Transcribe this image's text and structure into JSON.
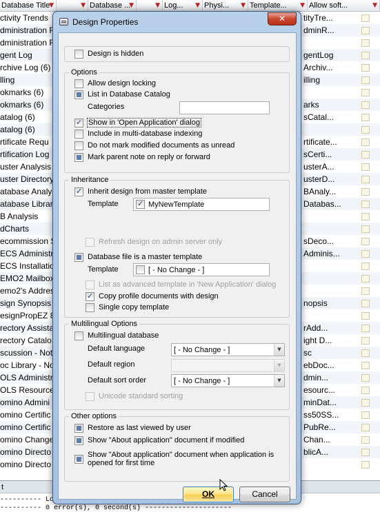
{
  "background": {
    "columns": [
      {
        "label": "Database Title",
        "width": 82
      },
      {
        "label": "",
        "width": 46
      },
      {
        "label": "Database ...",
        "width": 70
      },
      {
        "label": "",
        "width": 38
      },
      {
        "label": "Log...",
        "width": 58
      },
      {
        "label": "Physi...",
        "width": 66
      },
      {
        "label": "Template...",
        "width": 86
      },
      {
        "label": "Allow soft...",
        "width": 105
      }
    ],
    "rows": [
      {
        "title": "ctivity Trends",
        "template": "tityTre..."
      },
      {
        "title": "dministration R",
        "template": "dminR..."
      },
      {
        "title": "dministration R",
        "template": ""
      },
      {
        "title": "gent Log",
        "template": "gentLog"
      },
      {
        "title": "rchive Log (6)",
        "template": "Archiv..."
      },
      {
        "title": "lling",
        "template": "illing"
      },
      {
        "title": "okmarks (6)",
        "template": ""
      },
      {
        "title": "okmarks (6)",
        "template": "arks"
      },
      {
        "title": "atalog (6)",
        "template": "sCatal..."
      },
      {
        "title": "atalog (6)",
        "template": ""
      },
      {
        "title": "rtificate Requ",
        "template": "rtificate..."
      },
      {
        "title": "rtification Log",
        "template": "sCerti..."
      },
      {
        "title": "uster Analysis",
        "template": "usterA..."
      },
      {
        "title": "uster Directory",
        "template": "usterD..."
      },
      {
        "title": "atabase Analys",
        "template": "BAnaly..."
      },
      {
        "title": "atabase Library",
        "template": "Databas..."
      },
      {
        "title": "B Analysis",
        "template": ""
      },
      {
        "title": "dCharts",
        "template": ""
      },
      {
        "title": "ecommission S",
        "template": "sDeco..."
      },
      {
        "title": "ECS Administra",
        "template": "Adminis..."
      },
      {
        "title": "ECS Installation",
        "template": ""
      },
      {
        "title": "EMO2 Mailbox",
        "template": ""
      },
      {
        "title": "emo2's Addres",
        "template": ""
      },
      {
        "title": "sign Synopsis",
        "template": "nopsis"
      },
      {
        "title": "esignPropEZ 8.",
        "template": ""
      },
      {
        "title": "rectory Assista",
        "template": "rAdd..."
      },
      {
        "title": "rectory Catalo",
        "template": "ight D..."
      },
      {
        "title": "scussion - Not",
        "template": "sc"
      },
      {
        "title": "oc Library - No",
        "template": "ebDoc..."
      },
      {
        "title": "OLS Administra",
        "template": "dmin..."
      },
      {
        "title": "OLS Resource",
        "template": "esourc..."
      },
      {
        "title": "omino Admini",
        "template": "minDat..."
      },
      {
        "title": "omino Certific",
        "template": "ss50SS..."
      },
      {
        "title": "omino Certific",
        "template": "PubRe..."
      },
      {
        "title": "omino Change",
        "template": "Chan..."
      },
      {
        "title": "omino Directo",
        "template": "blicA..."
      },
      {
        "title": "omino Directo",
        "template": ""
      }
    ],
    "status_tab": "t",
    "status_line1": "---------- Loading",
    "status_line2": "---------- 0 error(s), 0 second(s) ---------------------"
  },
  "dialog": {
    "title": "Design Properties",
    "close": "✕",
    "design_hidden": "Design is hidden",
    "options": {
      "title": "Options",
      "allow_locking": "Allow design locking",
      "list_catalog": "List in Database Catalog",
      "categories_label": "Categories",
      "categories_value": "",
      "show_open_app": "Show in 'Open Application' dialog",
      "multi_db_index": "Include in multi-database indexing",
      "no_mark_unread": "Do not mark modified documents as unread",
      "mark_parent": "Mark parent note on reply or forward"
    },
    "inheritance": {
      "title": "Inheritance",
      "inherit_master": "Inherit design from master template",
      "template_label": "Template",
      "template_value": "MyNewTemplate",
      "refresh_admin": "Refresh design on admin server only",
      "is_master": "Database file is a master template",
      "template_label2": "Template",
      "template_value2": "[ - No Change - ]",
      "list_advanced": "List as advanced template in 'New Application' dialog",
      "copy_profile": "Copy profile documents with design",
      "single_copy": "Single copy template"
    },
    "multilingual": {
      "title": "Multilingual Options",
      "multilingual_db": "Multilingual database",
      "default_language_label": "Default language",
      "default_language_value": "[ - No Change - ]",
      "default_region_label": "Default region",
      "default_region_value": "",
      "default_sort_label": "Default sort order",
      "default_sort_value": "[ - No Change - ]",
      "unicode_sort": "Unicode standard sorting"
    },
    "other": {
      "title": "Other options",
      "restore_last": "Restore as last viewed by user",
      "show_about_modified": "Show \"About application\" document if modified",
      "show_about_first_1": "Show \"About application\" document when application is",
      "show_about_first_2": "opened for first time"
    },
    "ok": "OK",
    "cancel": "Cancel"
  }
}
